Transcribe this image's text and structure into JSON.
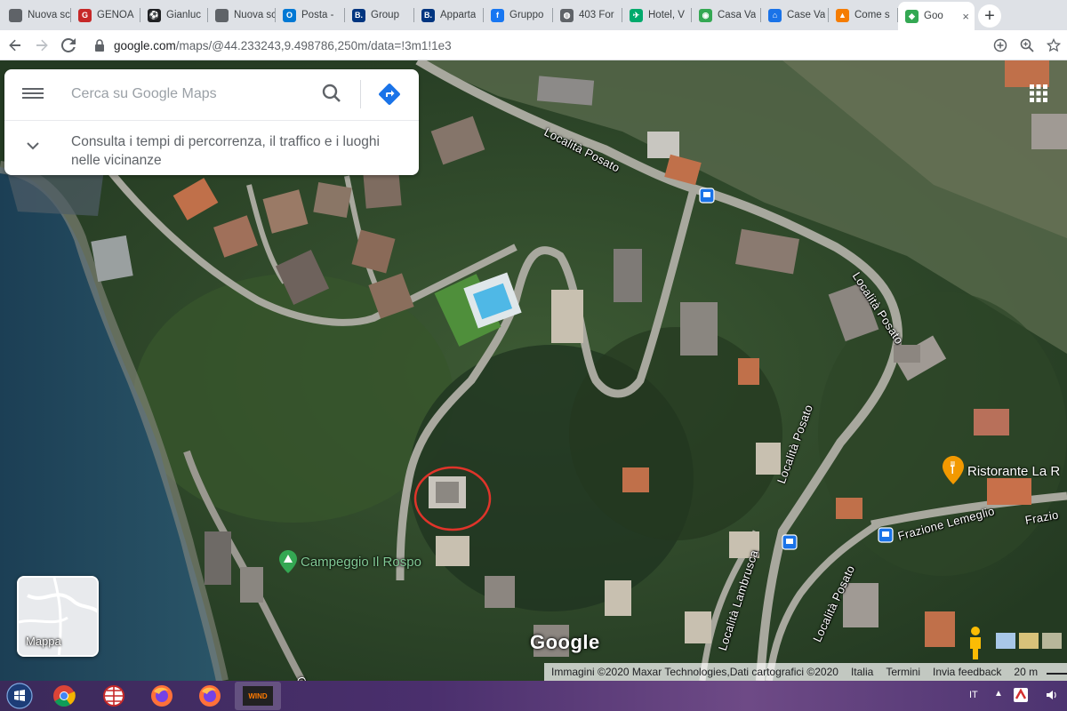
{
  "browser": {
    "tabs": [
      {
        "label": "Nuova sche",
        "icon": "blank-page-icon",
        "color": "#5f6368",
        "glyph": ""
      },
      {
        "label": "GENOA",
        "icon": "genoa-icon",
        "color": "#c62828",
        "glyph": "G"
      },
      {
        "label": "Gianluc",
        "icon": "soccer-ball-icon",
        "color": "#202124",
        "glyph": "⚽"
      },
      {
        "label": "Nuova sche",
        "icon": "blank-page-icon",
        "color": "#5f6368",
        "glyph": ""
      },
      {
        "label": "Posta -",
        "icon": "outlook-icon",
        "color": "#0078d4",
        "glyph": "O"
      },
      {
        "label": "Group",
        "icon": "booking-icon",
        "color": "#003580",
        "glyph": "B."
      },
      {
        "label": "Apparta",
        "icon": "booking-icon",
        "color": "#003580",
        "glyph": "B."
      },
      {
        "label": "Gruppo",
        "icon": "facebook-icon",
        "color": "#1877f2",
        "glyph": "f"
      },
      {
        "label": "403 For",
        "icon": "globe-icon",
        "color": "#5f6368",
        "glyph": "◍"
      },
      {
        "label": "Hotel, V",
        "icon": "tripadvisor-icon",
        "color": "#00aa6c",
        "glyph": "✈"
      },
      {
        "label": "Casa Va",
        "icon": "tripadvisor-icon",
        "color": "#34a853",
        "glyph": "◉"
      },
      {
        "label": "Case Va",
        "icon": "holiday-home-icon",
        "color": "#1a73e8",
        "glyph": "⌂"
      },
      {
        "label": "Come s",
        "icon": "triangle-app-icon",
        "color": "#f57c00",
        "glyph": "▲"
      }
    ],
    "active_tab": {
      "label": "Goo",
      "icon": "google-maps-icon",
      "color": "#34a853",
      "glyph": "◆",
      "close": "×"
    },
    "new_tab": "+",
    "url": {
      "host": "google.com",
      "path": "/maps/@44.233243,9.498786,250m/data=!3m1!1e3"
    }
  },
  "search": {
    "placeholder": "Cerca su Google Maps",
    "nearby": "Consulta i tempi di percorrenza, il traffico e i luoghi nelle vicinanze"
  },
  "map": {
    "road_labels": [
      "Località Posato",
      "Località Posato",
      "Località Posato",
      "Località Posato",
      "Località Lambrusca",
      "Frazione Lemeglio",
      "Frazio"
    ],
    "places": {
      "campsite": "Campeggio Il Rospo",
      "restaurant": "Ristorante La R"
    },
    "layer_toggle": "Mappa",
    "logo": "Google",
    "partial_road": "Ga",
    "attribution": {
      "imagery": "Immagini ©2020 Maxar Technologies,Dati cartografici ©2020",
      "country": "Italia",
      "terms": "Termini",
      "feedback": "Invia feedback",
      "scale": "20 m"
    }
  },
  "taskbar": {
    "apps": [
      "chrome-icon",
      "network-globe-icon",
      "firefox-icon",
      "firefox-icon",
      "wind-icon"
    ],
    "wind_label": "WIND",
    "lang": "IT",
    "tray_arrow": "▲"
  }
}
